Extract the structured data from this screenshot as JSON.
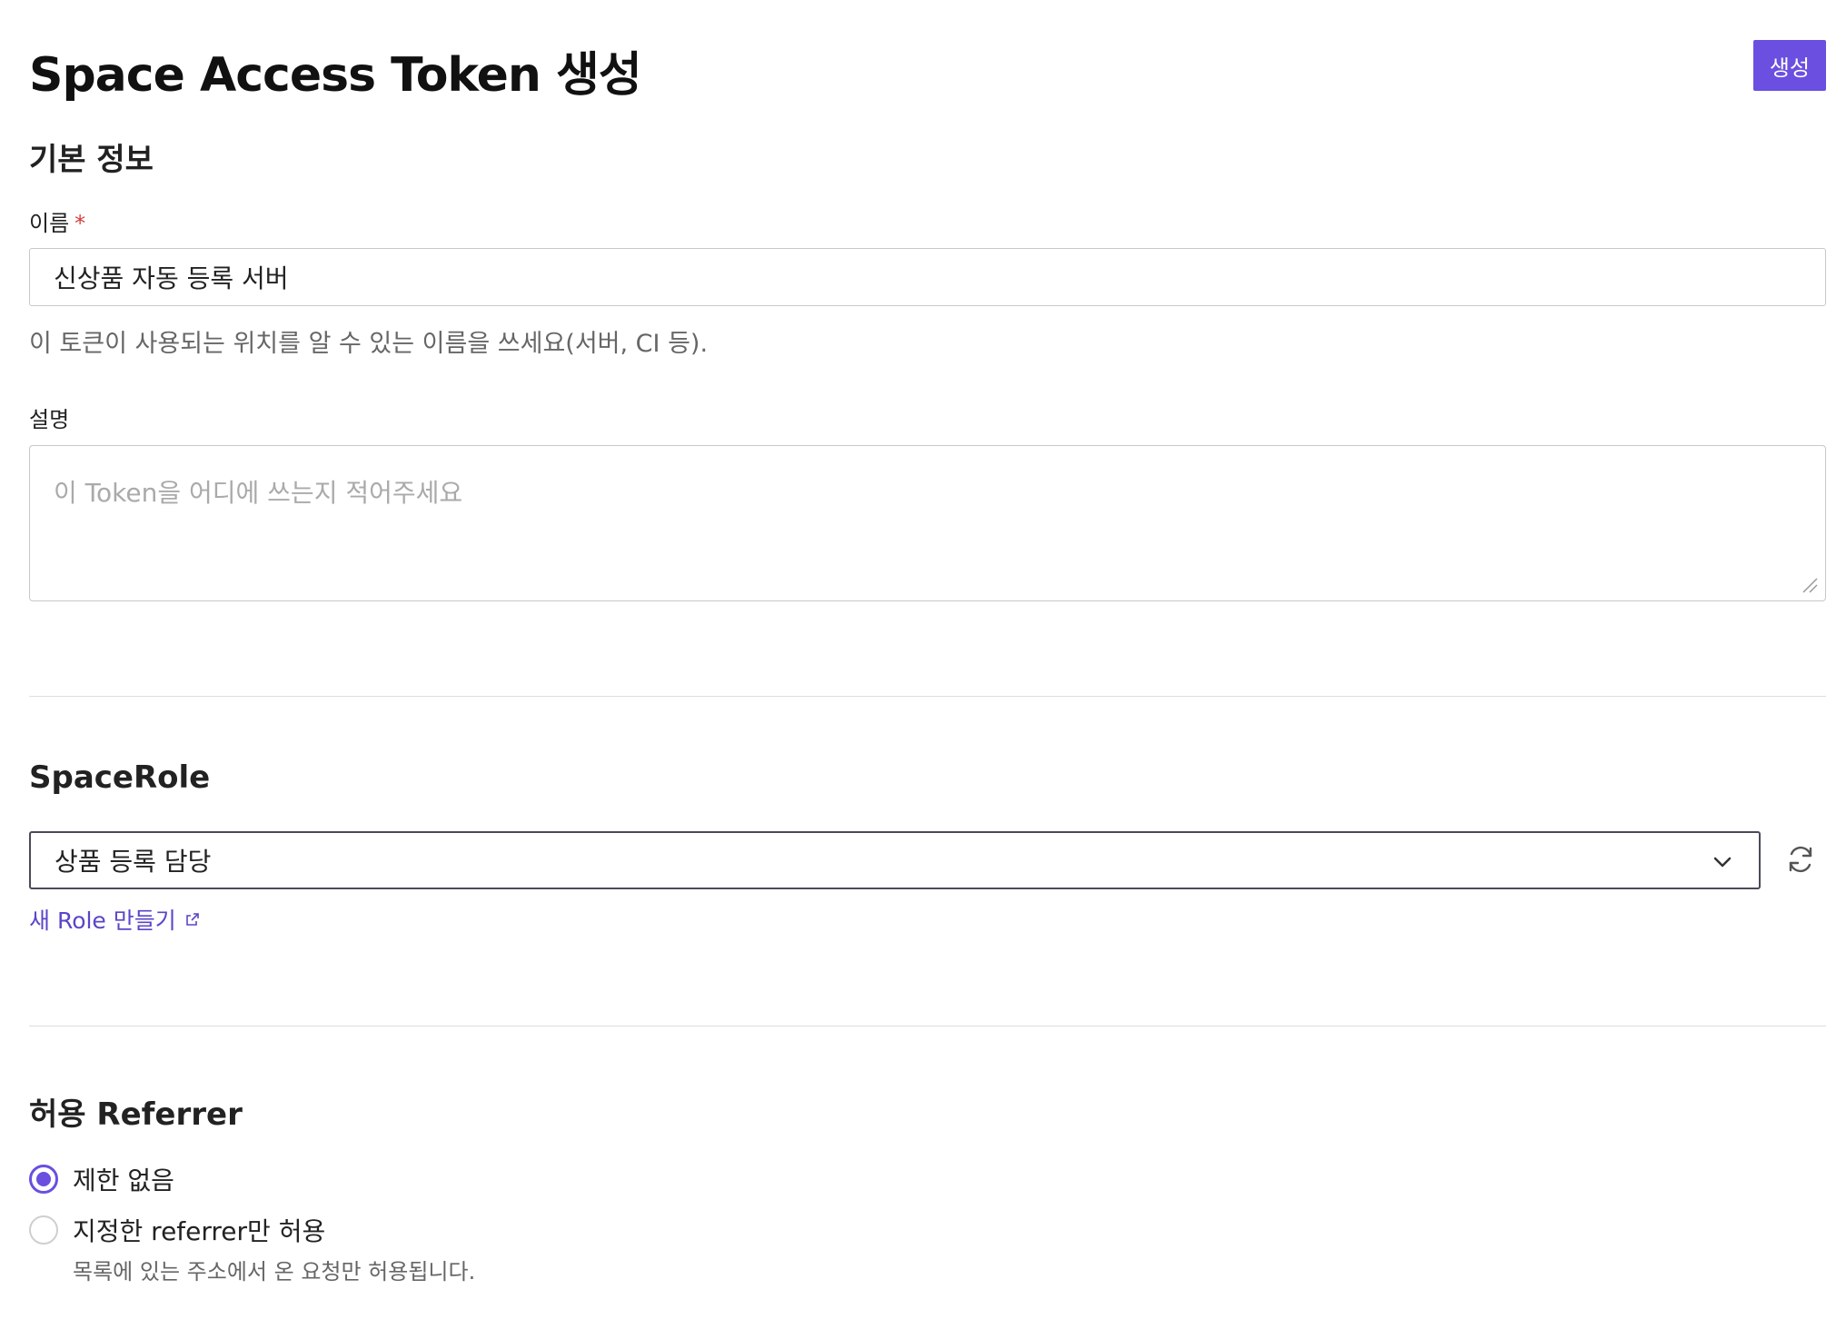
{
  "header": {
    "title": "Space Access Token 생성",
    "create_button": "생성"
  },
  "basic_info": {
    "section_title": "기본 정보",
    "name_label": "이름",
    "required_mark": "*",
    "name_value": "신상품 자동 등록 서버",
    "name_help": "이 토큰이 사용되는 위치를 알 수 있는 이름을 쓰세요(서버, CI 등).",
    "description_label": "설명",
    "description_placeholder": "이 Token을 어디에 쓰는지 적어주세요"
  },
  "space_role": {
    "section_title": "SpaceRole",
    "selected": "상품 등록 담당",
    "new_role_link": "새 Role 만들기"
  },
  "referrer": {
    "section_title": "허용 Referrer",
    "options": [
      {
        "label": "제한 없음",
        "checked": true
      },
      {
        "label": "지정한 referrer만 허용",
        "checked": false,
        "sublabel": "목록에 있는 주소에서 온 요청만 허용됩니다."
      }
    ]
  },
  "colors": {
    "accent": "#6a4fe0",
    "link": "#5a45c9",
    "required": "#d63c3c"
  }
}
